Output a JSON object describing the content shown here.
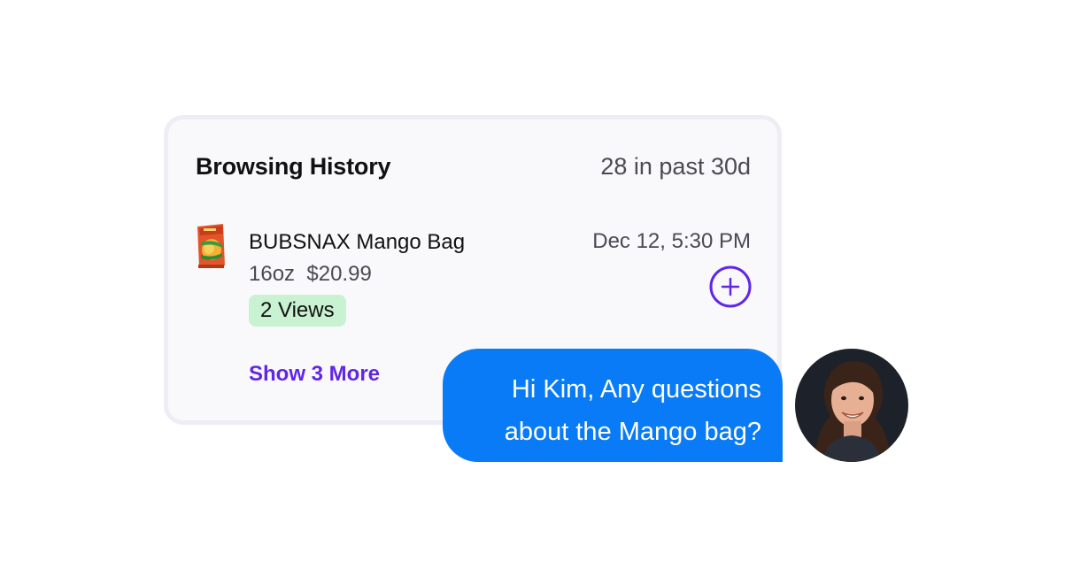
{
  "card": {
    "title": "Browsing History",
    "count": "28 in past 30d",
    "product": {
      "name": "BUBSNAX Mango Bag",
      "meta": "16oz  $20.99",
      "views": "2 Views",
      "date": "Dec 12, 5:30 PM",
      "thumbnail_icon": "mango-snack-bag-thumbnail",
      "add_icon": "plus-circle-icon"
    },
    "show_more": "Show 3 More"
  },
  "chat": {
    "line1": "Hi Kim, Any questions",
    "line2": "about the Mango bag?",
    "avatar_icon": "agent-avatar"
  },
  "colors": {
    "card_background": "#f9f9fc",
    "card_border": "#ededf3",
    "accent_purple": "#6226e6",
    "views_badge": "#c9f2d2",
    "chat_bubble": "#0a7bf6"
  }
}
